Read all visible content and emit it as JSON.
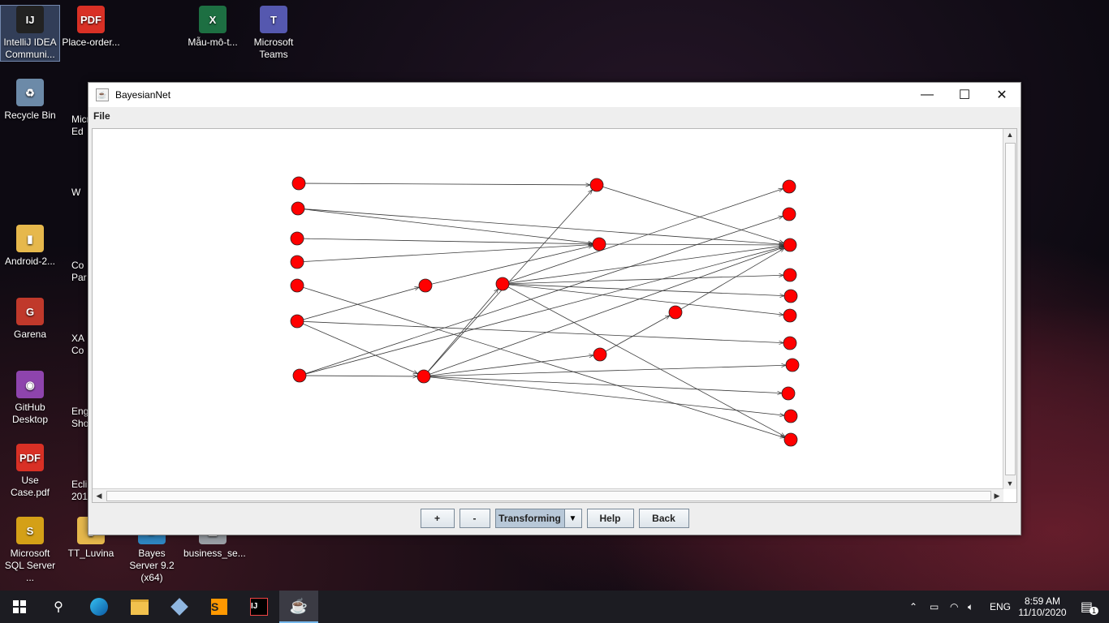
{
  "desktop": {
    "icons": [
      {
        "id": "intellij",
        "label": "IntelliJ IDEA Communi...",
        "glyph": "IJ",
        "color": "#222222"
      },
      {
        "id": "place-order",
        "label": "Place-order...",
        "glyph": "PDF",
        "color": "#d93025"
      },
      {
        "id": "mau-mo",
        "label": "Mẫu-mô-t...",
        "glyph": "X",
        "color": "#1d6f42"
      },
      {
        "id": "teams",
        "label": "Microsoft Teams",
        "glyph": "T",
        "color": "#5558af"
      },
      {
        "id": "recycle",
        "label": "Recycle Bin",
        "glyph": "♻",
        "color": "#6c8aa8"
      },
      {
        "id": "android",
        "label": "Android-2...",
        "glyph": "▮",
        "color": "#e6b84c"
      },
      {
        "id": "garena",
        "label": "Garena",
        "glyph": "G",
        "color": "#c0392b"
      },
      {
        "id": "github",
        "label": "GitHub Desktop",
        "glyph": "◉",
        "color": "#8e44ad"
      },
      {
        "id": "usecase",
        "label": "Use Case.pdf",
        "glyph": "PDF",
        "color": "#d93025"
      },
      {
        "id": "sqlserver",
        "label": "Microsoft SQL Server ...",
        "glyph": "S",
        "color": "#d4a017"
      },
      {
        "id": "ttluvina",
        "label": "TT_Luvina",
        "glyph": "▮",
        "color": "#e6b84c"
      },
      {
        "id": "bayes",
        "label": "Bayes Server 9.2 (x64)",
        "glyph": "B",
        "color": "#2e86c1"
      },
      {
        "id": "business",
        "label": "business_se...",
        "glyph": "▤",
        "color": "#9aa0a6"
      }
    ],
    "partials": [
      "Micr Ed",
      "W",
      "Co Par",
      "XA Co",
      "Eng Sho",
      "Eclip 201"
    ]
  },
  "window": {
    "title": "BayesianNet",
    "menu": [
      "File"
    ],
    "buttons": {
      "plus": "+",
      "minus": "-",
      "help": "Help",
      "back": "Back"
    },
    "mode": "Transforming"
  },
  "graph": {
    "node_color": "#ff0000",
    "nodes": [
      {
        "id": "a1"
      },
      {
        "id": "a2"
      },
      {
        "id": "a3"
      },
      {
        "id": "a4"
      },
      {
        "id": "a5"
      },
      {
        "id": "a6"
      },
      {
        "id": "a7"
      },
      {
        "id": "b1"
      },
      {
        "id": "b2"
      },
      {
        "id": "c1"
      },
      {
        "id": "d1"
      },
      {
        "id": "d2"
      },
      {
        "id": "d3"
      },
      {
        "id": "e1"
      },
      {
        "id": "f1"
      },
      {
        "id": "f2"
      },
      {
        "id": "f3"
      },
      {
        "id": "f4"
      },
      {
        "id": "f5"
      },
      {
        "id": "f6"
      },
      {
        "id": "f7"
      },
      {
        "id": "f8"
      },
      {
        "id": "f9"
      },
      {
        "id": "f10"
      },
      {
        "id": "f11"
      }
    ],
    "edges": [
      [
        "a1",
        "d1"
      ],
      [
        "a2",
        "d2"
      ],
      [
        "a2",
        "f3"
      ],
      [
        "a3",
        "d2"
      ],
      [
        "a4",
        "d2"
      ],
      [
        "a5",
        "f11"
      ],
      [
        "a6",
        "b1"
      ],
      [
        "a6",
        "b2"
      ],
      [
        "a6",
        "f7"
      ],
      [
        "a7",
        "b2"
      ],
      [
        "a7",
        "f2"
      ],
      [
        "a7",
        "f3"
      ],
      [
        "b1",
        "d2"
      ],
      [
        "b2",
        "c1"
      ],
      [
        "b2",
        "d1"
      ],
      [
        "b2",
        "d3"
      ],
      [
        "b2",
        "f3"
      ],
      [
        "b2",
        "f8"
      ],
      [
        "b2",
        "f9"
      ],
      [
        "b2",
        "f10"
      ],
      [
        "c1",
        "f1"
      ],
      [
        "c1",
        "f3"
      ],
      [
        "c1",
        "f4"
      ],
      [
        "c1",
        "f5"
      ],
      [
        "c1",
        "f6"
      ],
      [
        "c1",
        "f11"
      ],
      [
        "d1",
        "f3"
      ],
      [
        "d2",
        "f3"
      ],
      [
        "d3",
        "e1"
      ],
      [
        "e1",
        "f3"
      ]
    ]
  },
  "taskbar": {
    "lang": "ENG",
    "time": "8:59 AM",
    "date": "11/10/2020",
    "notifications": "1"
  }
}
